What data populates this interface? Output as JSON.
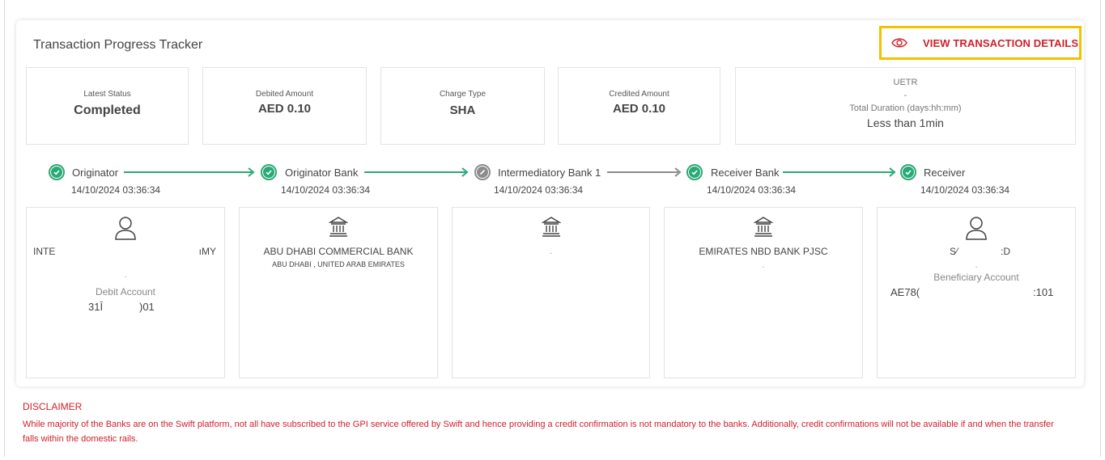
{
  "tracker": {
    "title": "Transaction Progress Tracker",
    "view_button_label": "VIEW TRANSACTION DETAILS"
  },
  "stats": {
    "latest_status": {
      "label": "Latest Status",
      "value": "Completed"
    },
    "debited_amount": {
      "label": "Debited Amount",
      "value": "AED 0.10"
    },
    "charge_type": {
      "label": "Charge Type",
      "value": "SHA"
    },
    "credited_amount": {
      "label": "Credited Amount",
      "value": "AED 0.10"
    },
    "uetr": {
      "label": "UETR",
      "value": "-",
      "duration_label": "Total Duration (days:hh:mm)",
      "duration_value": "Less than 1min"
    }
  },
  "steps": [
    {
      "name": "Originator",
      "date": "14/10/2024 03:36:34",
      "status": "completed"
    },
    {
      "name": "Originator Bank",
      "date": "14/10/2024 03:36:34",
      "status": "completed"
    },
    {
      "name": "Intermediatory Bank 1",
      "date": "14/10/2024 03:36:34",
      "status": "skipped"
    },
    {
      "name": "Receiver Bank",
      "date": "14/10/2024 03:36:34",
      "status": "completed"
    },
    {
      "name": "Receiver",
      "date": "14/10/2024 03:36:34",
      "status": "completed"
    }
  ],
  "parties": {
    "originator": {
      "icon": "person-icon",
      "name_left": "INTE",
      "name_right": "ıMY",
      "dot": ".",
      "account_label": "Debit Account",
      "account_left": "31Ī",
      "account_right": ")01"
    },
    "originator_bank": {
      "icon": "bank-icon",
      "name": "ABU DHABI COMMERCIAL BANK",
      "address": "ABU DHABI , UNITED ARAB EMIRATES"
    },
    "intermediary_bank": {
      "icon": "bank-icon",
      "dot": "."
    },
    "receiver_bank": {
      "icon": "bank-icon",
      "name": "EMIRATES NBD BANK PJSC",
      "dot": "."
    },
    "receiver": {
      "icon": "person-icon",
      "name_left": "S⁄",
      "name_right": ":D",
      "dot": ".",
      "account_label": "Beneficiary Account",
      "account_left": "AE78(",
      "account_right": ":101"
    }
  },
  "disclaimer": {
    "title": "DISCLAIMER",
    "text": "While majority of the Banks are on the Swift platform, not all have subscribed to the GPI service offered by Swift and hence providing a credit confirmation is not mandatory to the banks. Additionally, credit confirmations will not be available if and when the transfer falls within the domestic rails."
  },
  "colors": {
    "accent_red": "#d0202b",
    "success_green": "#2aa976",
    "highlight_yellow": "#f2c200",
    "neutral_grey": "#8c8c8c"
  }
}
